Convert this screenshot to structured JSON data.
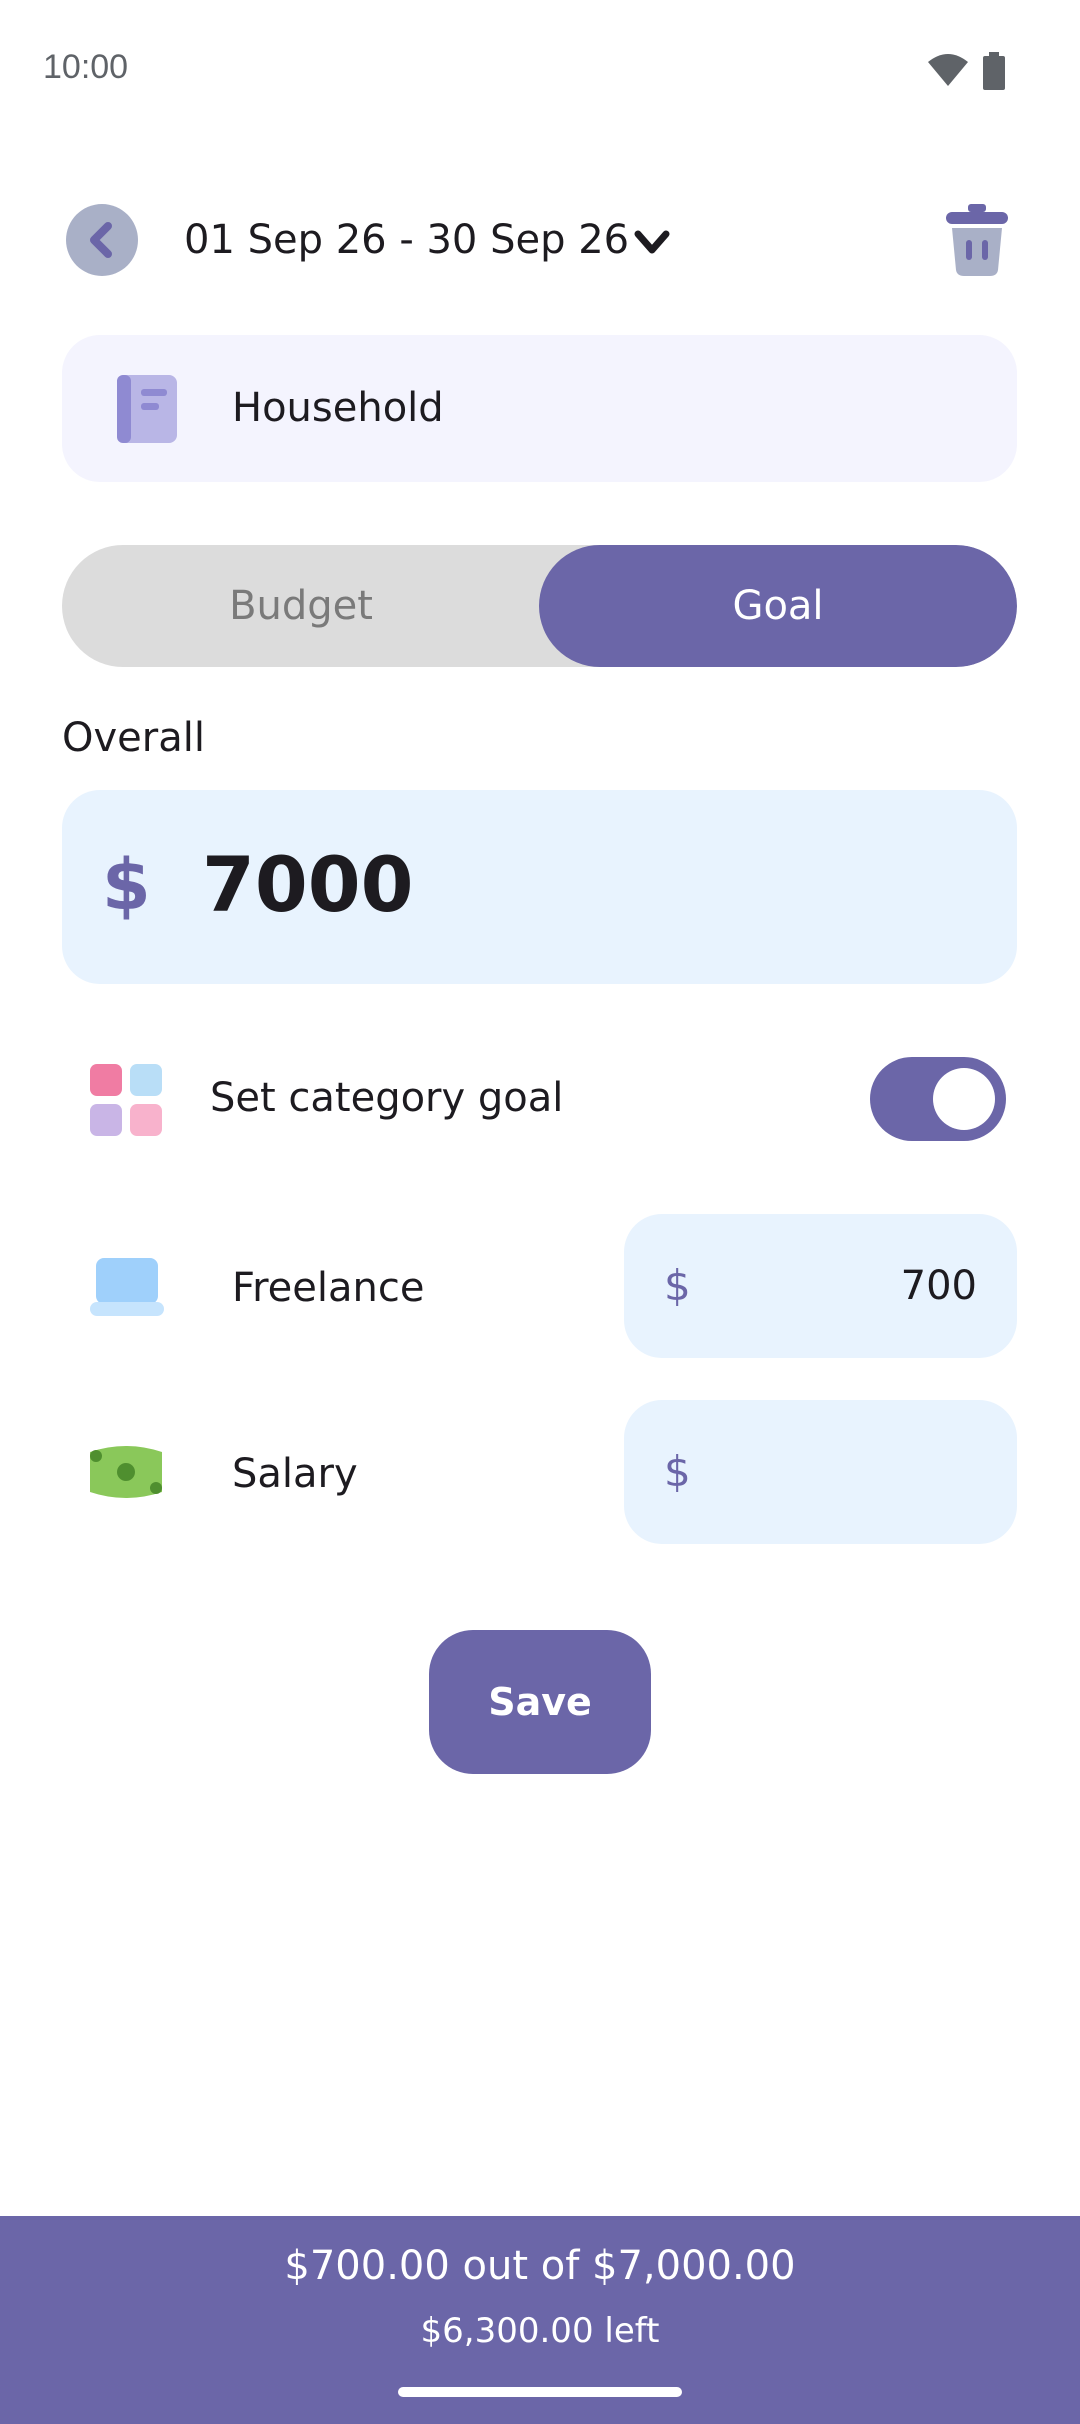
{
  "status_bar": {
    "time": "10:00"
  },
  "header": {
    "date_range": "01 Sep 26 - 30 Sep 26"
  },
  "category": {
    "name": "Household"
  },
  "tabs": {
    "budget_label": "Budget",
    "goal_label": "Goal",
    "selected": "Goal"
  },
  "overall": {
    "label": "Overall",
    "currency": "$",
    "amount": "7000"
  },
  "category_goal": {
    "label": "Set category goal",
    "enabled": true
  },
  "rows": [
    {
      "label": "Freelance",
      "currency": "$",
      "value": "700"
    },
    {
      "label": "Salary",
      "currency": "$",
      "value": ""
    }
  ],
  "actions": {
    "save_label": "Save"
  },
  "footer": {
    "summary": "$700.00 out of $7,000.00",
    "left": "$6,300.00 left"
  },
  "colors": {
    "accent": "#6b66a8",
    "field_bg": "#e8f3fe",
    "card_bg": "#f4f4fe"
  }
}
